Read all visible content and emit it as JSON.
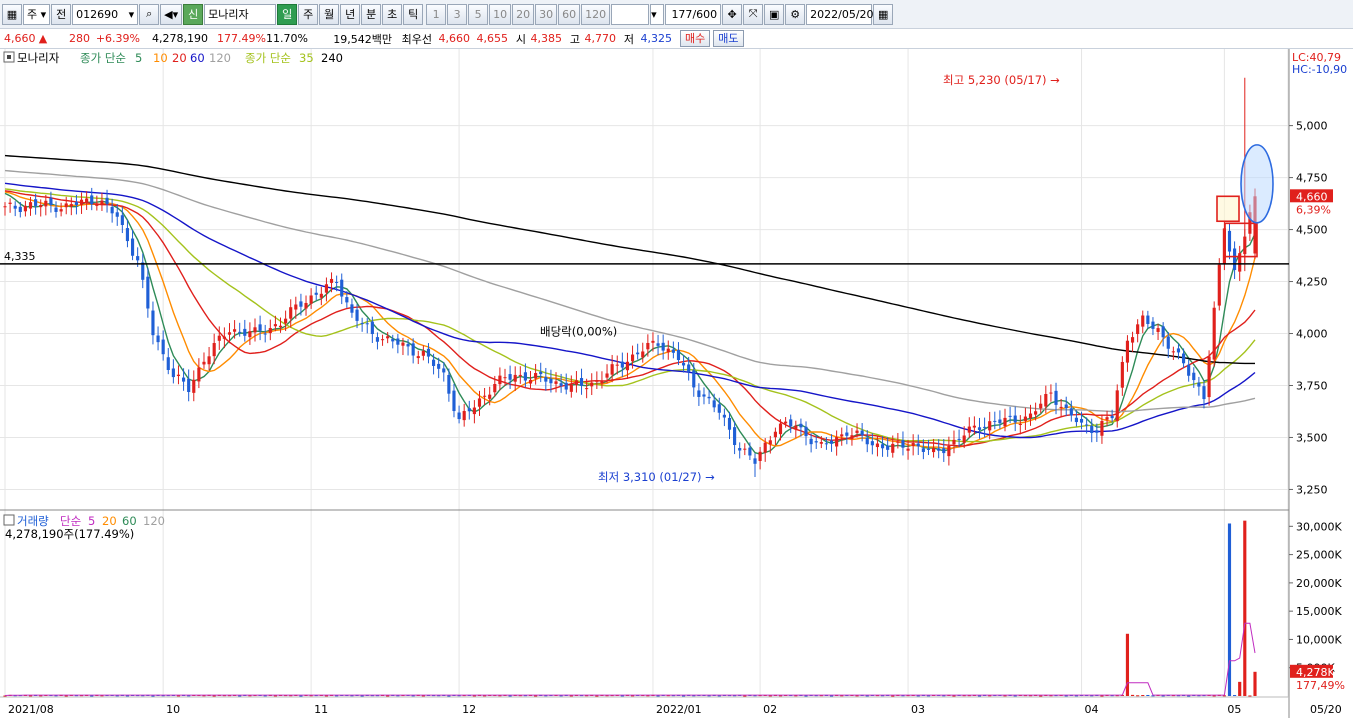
{
  "toolbar": {
    "market": "주",
    "prefix": "전",
    "code": "012690",
    "sin": "신",
    "stock_name": "모나리자",
    "periods": [
      "일",
      "주",
      "월",
      "년",
      "분",
      "초",
      "틱"
    ],
    "active_period": "일",
    "intervals": [
      "1",
      "3",
      "5",
      "10",
      "20",
      "30",
      "60",
      "120"
    ],
    "count": "177",
    "count_total": "/600",
    "date": "2022/05/20"
  },
  "quote": {
    "price": "4,660",
    "arrow": "▲",
    "change": "280",
    "change_pct": "+6.39%",
    "volume": "4,278,190",
    "volume_pct": "177.49%",
    "turnover": "11.70%",
    "amount": "19,542백만",
    "best_ask_label": "최우선",
    "best_ask": "4,660",
    "best_bid": "4,655",
    "open_label": "시",
    "open": "4,385",
    "high_label": "고",
    "high": "4,770",
    "low_label": "저",
    "low": "4,325",
    "buy_label": "매수",
    "sell_label": "매도"
  },
  "colors": {
    "up": "#e0201c",
    "down": "#1f5fd6",
    "ma5": "#2e8b57",
    "ma10": "#ff8c00",
    "ma20": "#e0201c",
    "ma60": "#1515c8",
    "ma120": "#a0a0a0",
    "ma35": "#a4c21c",
    "ma240": "#000000",
    "vol_ma5": "#c02cc0"
  },
  "chart_data": {
    "type": "candlestick",
    "price_legend": {
      "name": "모나리자",
      "ma_label": "종가 단순",
      "ma_periods": [
        "5",
        "10",
        "20",
        "60",
        "120"
      ],
      "ma2_label": "종가 단순",
      "ma2_periods": [
        "35",
        "240"
      ]
    },
    "volume_legend": {
      "name": "거래량",
      "ma_label": "단순",
      "ma_periods": [
        "5",
        "20",
        "60",
        "120"
      ],
      "current": "4,278,190주(177.49%)"
    },
    "y_ticks": [
      "5,000",
      "4,750",
      "4,500",
      "4,250",
      "4,000",
      "3,750",
      "3,500",
      "3,250"
    ],
    "y_tick_values": [
      5000,
      4750,
      4500,
      4250,
      4000,
      3750,
      3500,
      3250
    ],
    "ylim": [
      3180,
      5330
    ],
    "vol_ticks": [
      "30,000K",
      "25,000K",
      "20,000K",
      "15,000K",
      "10,000K",
      "5,000K"
    ],
    "vol_tick_values": [
      30000,
      25000,
      20000,
      15000,
      10000,
      5000
    ],
    "vol_ylim": [
      0,
      32000
    ],
    "x_labels": [
      "2021/08",
      "10",
      "11",
      "12",
      "2022/01",
      "02",
      "03",
      "04",
      "05",
      "05/20"
    ],
    "x_label_index": [
      0,
      31,
      60,
      89,
      127,
      148,
      177,
      211,
      239,
      300
    ],
    "lc_label": "LC:40,79",
    "hc_label": "HC:-10,90",
    "last_price_tag": "4,660",
    "last_pct_tag": "6,39%",
    "last_vol_tag": "4,278K",
    "last_vol_pct_tag": "177,49%",
    "hline_label": "4,335",
    "hline_value": 4335,
    "high_annotation": "최고 5,230 (05/17) →",
    "high_value": 5230,
    "low_annotation": "최저 3,310 (01/27) →",
    "low_value": 3310,
    "div_annotation": "배당락(0,00%)",
    "close_anchors": [
      [
        0,
        4600
      ],
      [
        5,
        4620
      ],
      [
        12,
        4610
      ],
      [
        18,
        4650
      ],
      [
        22,
        4560
      ],
      [
        26,
        4350
      ],
      [
        29,
        4000
      ],
      [
        33,
        3800
      ],
      [
        36,
        3730
      ],
      [
        39,
        3880
      ],
      [
        44,
        4020
      ],
      [
        49,
        4000
      ],
      [
        54,
        4050
      ],
      [
        58,
        4150
      ],
      [
        62,
        4200
      ],
      [
        65,
        4260
      ],
      [
        68,
        4090
      ],
      [
        72,
        4000
      ],
      [
        77,
        3950
      ],
      [
        82,
        3900
      ],
      [
        86,
        3800
      ],
      [
        89,
        3580
      ],
      [
        92,
        3650
      ],
      [
        96,
        3760
      ],
      [
        100,
        3800
      ],
      [
        106,
        3780
      ],
      [
        111,
        3740
      ],
      [
        116,
        3770
      ],
      [
        121,
        3860
      ],
      [
        125,
        3920
      ],
      [
        128,
        3960
      ],
      [
        132,
        3880
      ],
      [
        135,
        3750
      ],
      [
        140,
        3620
      ],
      [
        144,
        3450
      ],
      [
        147,
        3380
      ],
      [
        151,
        3550
      ],
      [
        155,
        3560
      ],
      [
        160,
        3450
      ],
      [
        165,
        3530
      ],
      [
        170,
        3470
      ],
      [
        174,
        3450
      ],
      [
        178,
        3470
      ],
      [
        182,
        3420
      ],
      [
        186,
        3480
      ],
      [
        191,
        3560
      ],
      [
        196,
        3580
      ],
      [
        201,
        3600
      ],
      [
        205,
        3720
      ],
      [
        208,
        3620
      ],
      [
        211,
        3560
      ],
      [
        214,
        3540
      ],
      [
        217,
        3600
      ],
      [
        220,
        3980
      ],
      [
        223,
        4060
      ],
      [
        226,
        4020
      ],
      [
        230,
        3880
      ],
      [
        233,
        3780
      ],
      [
        235,
        3700
      ],
      [
        237,
        4100
      ],
      [
        239,
        4520
      ],
      [
        241,
        4300
      ],
      [
        243,
        4480
      ],
      [
        245,
        4660
      ]
    ],
    "volume_spikes": [
      [
        220,
        11000
      ],
      [
        240,
        30500
      ],
      [
        242,
        2500
      ],
      [
        243,
        31000
      ],
      [
        245,
        4278
      ]
    ]
  }
}
